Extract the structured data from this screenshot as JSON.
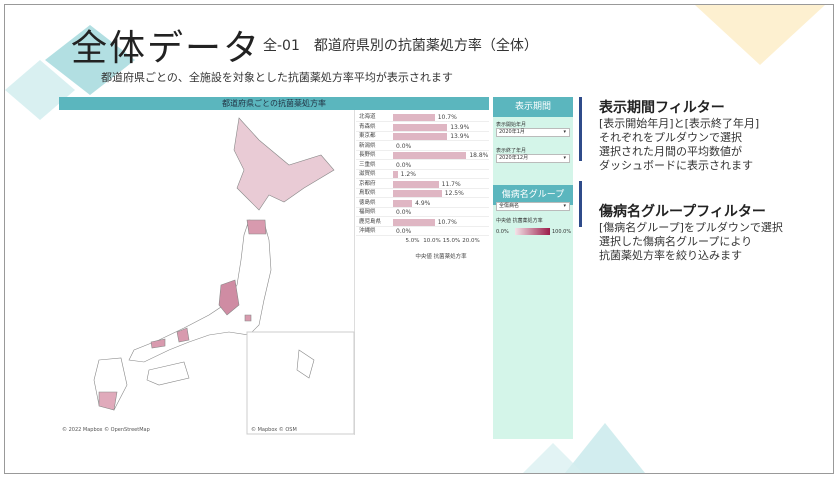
{
  "title": "全体データ",
  "subtitle": "全-01　都道府県別の抗菌薬処方率（全体）",
  "description": "都道府県ごとの、全施設を対象とした抗菌薬処方率平均が表示されます",
  "dashboard": {
    "header": "都道府県ごとの抗菌薬処方率",
    "map_credit": "© 2022 Mapbox © OpenStreetMap",
    "inset_credit": "© Mapbox © OSM",
    "colors": {
      "header": "#5bb6be",
      "panel": "#d4f5e9",
      "bar": "#dfb6c3",
      "dark": "#9c1c4a"
    }
  },
  "chart_data": {
    "type": "bar",
    "categories": [
      "北海道",
      "青森県",
      "東京都",
      "新潟県",
      "長野県",
      "三重県",
      "滋賀県",
      "京都府",
      "鳥取県",
      "徳島県",
      "福岡県",
      "鹿児島県",
      "沖縄県"
    ],
    "values": [
      10.7,
      13.9,
      13.9,
      0.0,
      18.8,
      0.0,
      1.2,
      11.7,
      12.5,
      4.9,
      0.0,
      10.7,
      0.0
    ],
    "value_labels": [
      "10.7%",
      "13.9%",
      "13.9%",
      "0.0%",
      "18.8%",
      "0.0%",
      "1.2%",
      "11.7%",
      "12.5%",
      "4.9%",
      "0.0%",
      "10.7%",
      "0.0%"
    ],
    "xticks": [
      "5.0%",
      "10.0%",
      "15.0%",
      "20.0%"
    ],
    "xtick_values": [
      5,
      10,
      15,
      20
    ],
    "xlabel": "中央値 抗菌薬処方率",
    "xlim": [
      0,
      22
    ]
  },
  "filters": {
    "period_header": "表示期間",
    "start_label": "表示開始年月",
    "start_value": "2020年1月",
    "end_label": "表示終了年月",
    "end_value": "2020年12月",
    "disease_header": "傷病名グループ",
    "disease_value": "全傷病名",
    "legend_title": "中央値 抗菌薬処方率",
    "legend_min": "0.0%",
    "legend_max": "100.0%"
  },
  "annotations": {
    "period_title": "表示期間フィルター",
    "period_lines": [
      "[表示開始年月]と[表示終了年月]",
      "それぞれをプルダウンで選択",
      "選択された月間の平均数値が",
      "ダッシュボードに表示されます"
    ],
    "disease_title": "傷病名グループフィルター",
    "disease_lines": [
      "[傷病名グループ]をプルダウンで選択",
      "選択した傷病名グループにより",
      "抗菌薬処方率を絞り込みます"
    ]
  }
}
